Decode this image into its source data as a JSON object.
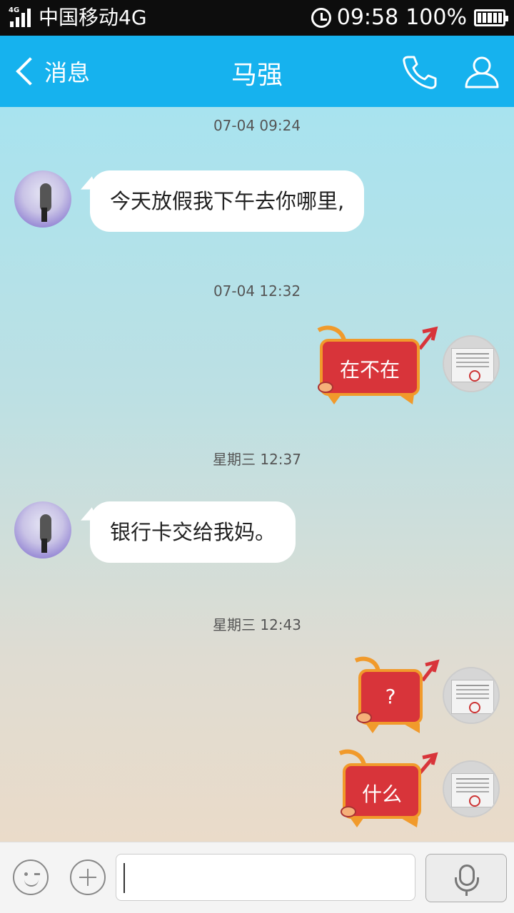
{
  "status_bar": {
    "network_badge": "4G",
    "carrier": "中国移动4G",
    "time": "09:58",
    "battery": "100%"
  },
  "nav": {
    "back_label": "消息",
    "title": "马强",
    "call_icon": "phone-icon",
    "profile_icon": "person-icon"
  },
  "messages": [
    {
      "timestamp": "07-04 09:24",
      "sender": "other",
      "text": "今天放假我下午去你哪里,"
    },
    {
      "timestamp": "07-04 12:32",
      "sender": "me",
      "type": "sticker",
      "text": "在不在"
    },
    {
      "timestamp": "星期三 12:37",
      "sender": "other",
      "text": "银行卡交给我妈。"
    },
    {
      "timestamp": "星期三 12:43",
      "sender": "me",
      "type": "sticker",
      "text": "?"
    },
    {
      "sender": "me",
      "type": "sticker",
      "text": "什么"
    }
  ],
  "input_bar": {
    "emoji_icon": "emoji-icon",
    "plus_icon": "plus-icon",
    "input_value": "",
    "voice_icon": "microphone-icon"
  },
  "colors": {
    "nav_bg": "#16b2ee",
    "sticker_red": "#d8343a",
    "sticker_orange": "#f19a2b"
  }
}
